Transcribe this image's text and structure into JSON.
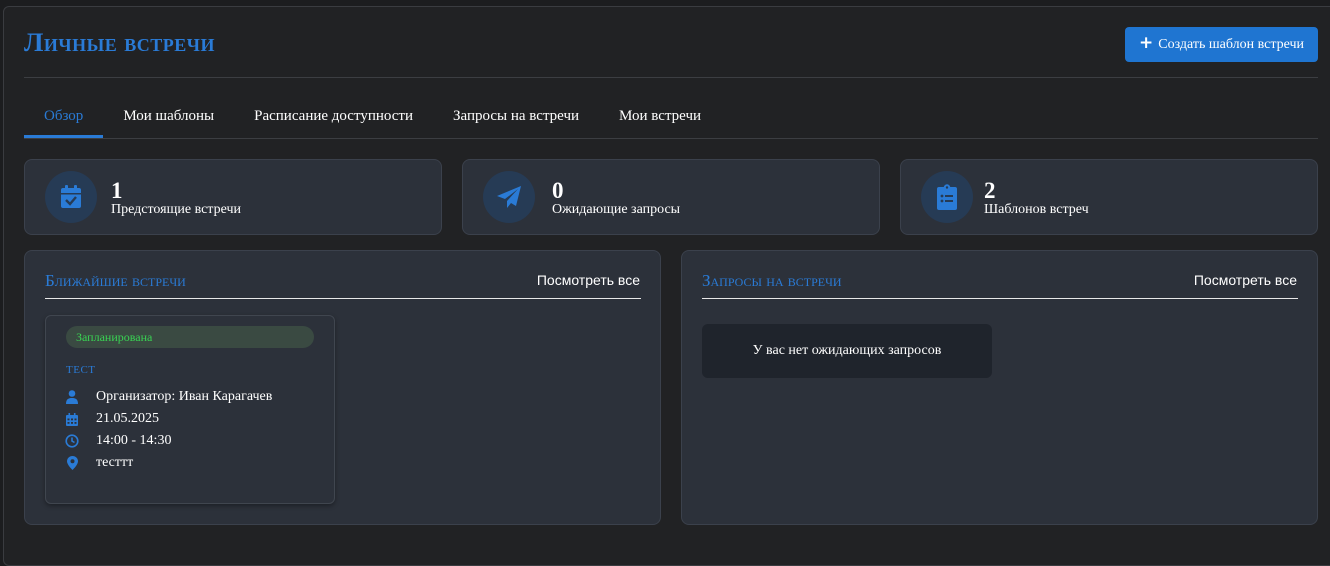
{
  "header": {
    "title": "Личные встречи",
    "create_button": "Создать шаблон встречи"
  },
  "tabs": [
    {
      "label": "Обзор",
      "active": true
    },
    {
      "label": "Мои шаблоны",
      "active": false
    },
    {
      "label": "Расписание доступности",
      "active": false
    },
    {
      "label": "Запросы на встречи",
      "active": false
    },
    {
      "label": "Мои встречи",
      "active": false
    }
  ],
  "stats": [
    {
      "value": "1",
      "label": "Предстоящие встречи",
      "icon": "calendar-check-icon"
    },
    {
      "value": "0",
      "label": "Ожидающие запросы",
      "icon": "paper-plane-icon"
    },
    {
      "value": "2",
      "label": "Шаблонов встреч",
      "icon": "clipboard-list-icon"
    }
  ],
  "upcoming": {
    "title": "Ближайшие встречи",
    "view_all": "Посмотреть все",
    "meeting": {
      "status": "Запланирована",
      "title": "тест",
      "organizer": "Организатор: Иван Карагачев",
      "date": "21.05.2025",
      "time": "14:00 - 14:30",
      "location": "тесттт"
    }
  },
  "requests": {
    "title": "Запросы на встречи",
    "view_all": "Посмотреть все",
    "empty_text": "У вас нет ожидающих запросов"
  },
  "colors": {
    "accent": "#2a7bd6",
    "button": "#1f75d1",
    "status_green": "#39d353",
    "card_bg": "#2c313a",
    "page_bg": "#212224"
  }
}
